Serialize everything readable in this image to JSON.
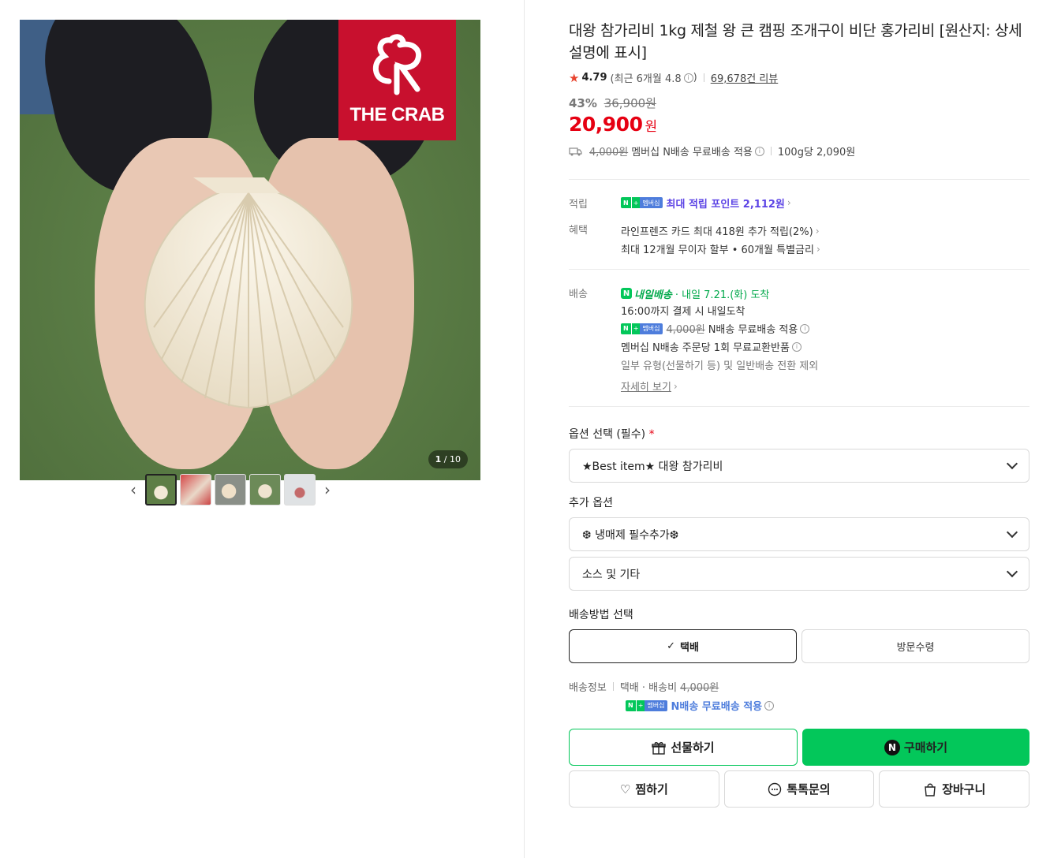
{
  "gallery": {
    "logo_text": "THE CRAB",
    "counter_current": "1",
    "counter_total": "/ 10",
    "prev_icon": "chevron-left-icon",
    "next_icon": "chevron-right-icon",
    "thumbnail_count": 5
  },
  "product": {
    "title": "대왕 참가리비 1kg 제철 왕 큰 캠핑 조개구이 비단 홍가리비 [원산지: 상세설명에 표시]",
    "rating": "4.79",
    "rating_recent": "(최근 6개월 4.8",
    "rating_recent_close": ")",
    "review_count": "69,678건 리뷰",
    "discount_pct": "43%",
    "original_price": "36,900원",
    "price": "20,900",
    "price_unit": "원",
    "shipping_fee_struck": "4,000원",
    "shipping_text": "멤버십 N배송 무료배송 적용",
    "unit_price": "100g당 2,090원"
  },
  "benefits": {
    "points_label": "적립",
    "points_badge_n": "N",
    "points_badge_plus": "+",
    "points_badge_member": "멤버십",
    "points_text": "최대 적립 포인트 2,112원",
    "benefit_label": "혜택",
    "benefit_line1": "라인프렌즈 카드 최대 418원 추가 적립(2%)",
    "benefit_line2": "최대 12개월 무이자 할부 • 60개월 특별금리"
  },
  "delivery": {
    "label": "배송",
    "tomorrow_badge": "내일배송",
    "arrival": "· 내일 7.21.(화) 도착",
    "cutoff": "16:00까지 결제 시 내일도착",
    "free_ship_struck": "4,000원",
    "free_ship_text": "N배송 무료배송 적용",
    "exchange": "멤버십 N배송 주문당 1회 무료교환반품",
    "exclusion": "일부 유형(선물하기 등) 및 일반배송 전환 제외",
    "more": "자세히 보기"
  },
  "options": {
    "required_label": "옵션 선택 (필수)",
    "required_mark": "*",
    "required_value": "★Best item★ 대왕 참가리비",
    "extra_label": "추가 옵션",
    "extra1_value": "❆ 냉매제 필수추가❆",
    "extra2_value": "소스 및 기타",
    "method_label": "배송방법 선택",
    "method_courier": "택배",
    "method_pickup": "방문수령",
    "dinfo_label": "배송정보",
    "dinfo_type": "택배 · 배송비",
    "dinfo_fee": "4,000원",
    "dinfo_free": "N배송 무료배송 적용"
  },
  "actions": {
    "gift": "선물하기",
    "buy": "구매하기",
    "wish": "찜하기",
    "talk": "톡톡문의",
    "cart": "장바구니"
  },
  "colors": {
    "accent_green": "#03c75a",
    "price_red": "#e60012",
    "brand_red": "#c8102e",
    "points_purple": "#5c44e5"
  }
}
